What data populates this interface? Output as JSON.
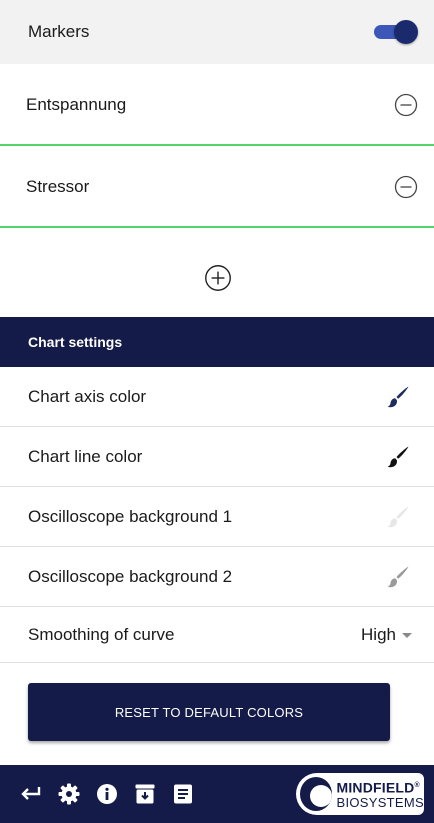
{
  "markers": {
    "label": "Markers",
    "enabled": true
  },
  "marker_items": [
    {
      "label": "Entspannung"
    },
    {
      "label": "Stressor"
    }
  ],
  "add_marker_icon": "plus-circle-icon",
  "chart_settings": {
    "header": "Chart settings",
    "rows": [
      {
        "label": "Chart axis color",
        "brush_color": "#1e2d5e"
      },
      {
        "label": "Chart line color",
        "brush_color": "#111111"
      },
      {
        "label": "Oscilloscope background 1",
        "brush_color": "#e6e6e6"
      },
      {
        "label": "Oscilloscope background 2",
        "brush_color": "#9a9a9a"
      }
    ],
    "smoothing": {
      "label": "Smoothing of curve",
      "value": "High"
    }
  },
  "reset_button": {
    "label": "RESET TO DEFAULT COLORS"
  },
  "bottom_bar": {
    "icons": [
      "back-arrow-icon",
      "gear-icon",
      "info-icon",
      "archive-icon",
      "notes-icon"
    ],
    "logo": {
      "line1": "MINDFIELD",
      "line2": "BIOSYSTEMS",
      "mark": "®"
    }
  },
  "colors": {
    "navy": "#141b48",
    "accent_green": "#52d36b",
    "toggle_track": "#3c57b8",
    "row_bg": "#f2f2f2"
  }
}
